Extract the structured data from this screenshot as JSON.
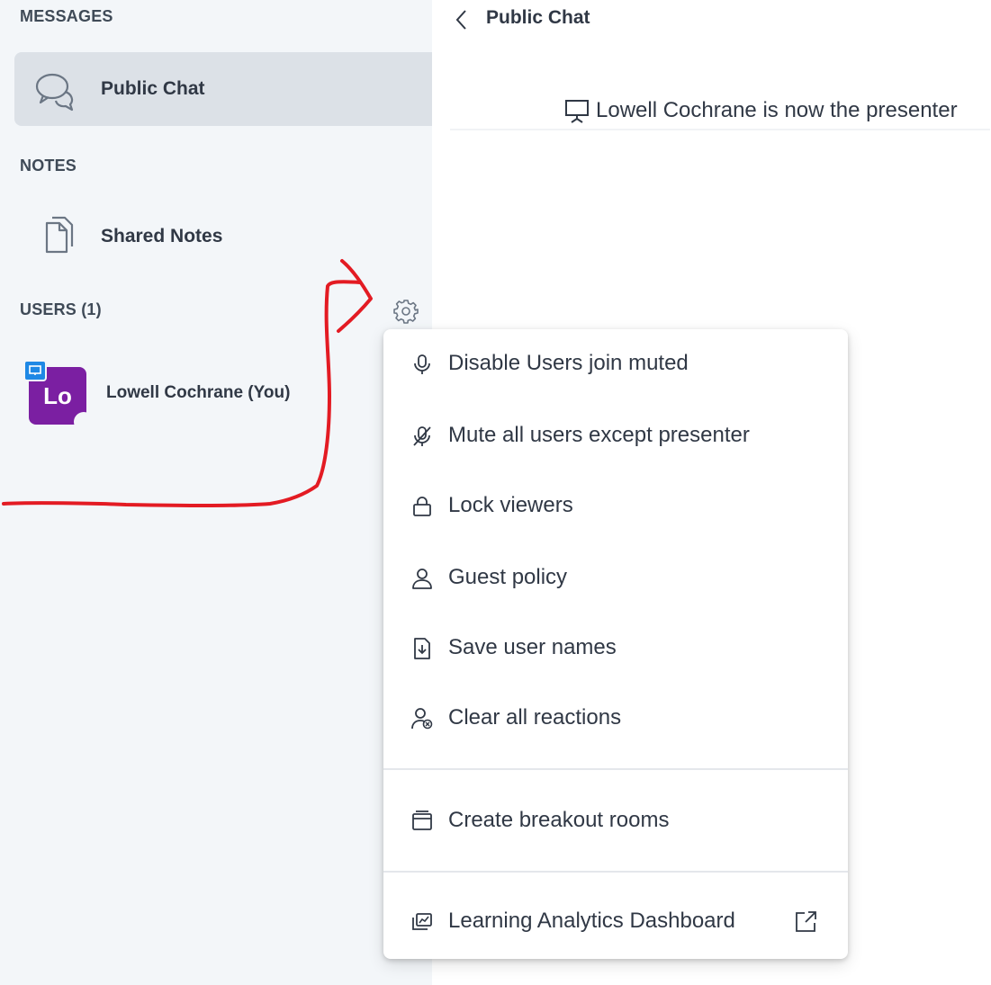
{
  "sidebar": {
    "messages_title": "MESSAGES",
    "public_chat_label": "Public Chat",
    "notes_title": "NOTES",
    "shared_notes_label": "Shared Notes",
    "users_title": "USERS (1)",
    "user": {
      "initials": "Lo",
      "name": "Lowell Cochrane (You)"
    }
  },
  "chat": {
    "header_title": "Public Chat",
    "system_message": "Lowell Cochrane is now the presenter"
  },
  "menu": {
    "items": [
      {
        "label": "Disable Users join muted",
        "icon": "microphone-icon"
      },
      {
        "label": "Mute all users except presenter",
        "icon": "microphone-muted-icon"
      },
      {
        "label": "Lock viewers",
        "icon": "lock-icon"
      },
      {
        "label": "Guest policy",
        "icon": "user-icon"
      },
      {
        "label": "Save user names",
        "icon": "download-file-icon"
      },
      {
        "label": "Clear all reactions",
        "icon": "user-clear-icon"
      },
      {
        "label": "Create breakout rooms",
        "icon": "breakout-rooms-icon"
      },
      {
        "label": "Learning Analytics Dashboard",
        "icon": "analytics-dashboard-icon"
      }
    ]
  },
  "colors": {
    "sidebar_bg": "#f3f6f9",
    "active_item_bg": "#dce1e7",
    "avatar": "#7b1fa2",
    "presenter_badge": "#1e88e5",
    "annotation": "#e31b23"
  }
}
